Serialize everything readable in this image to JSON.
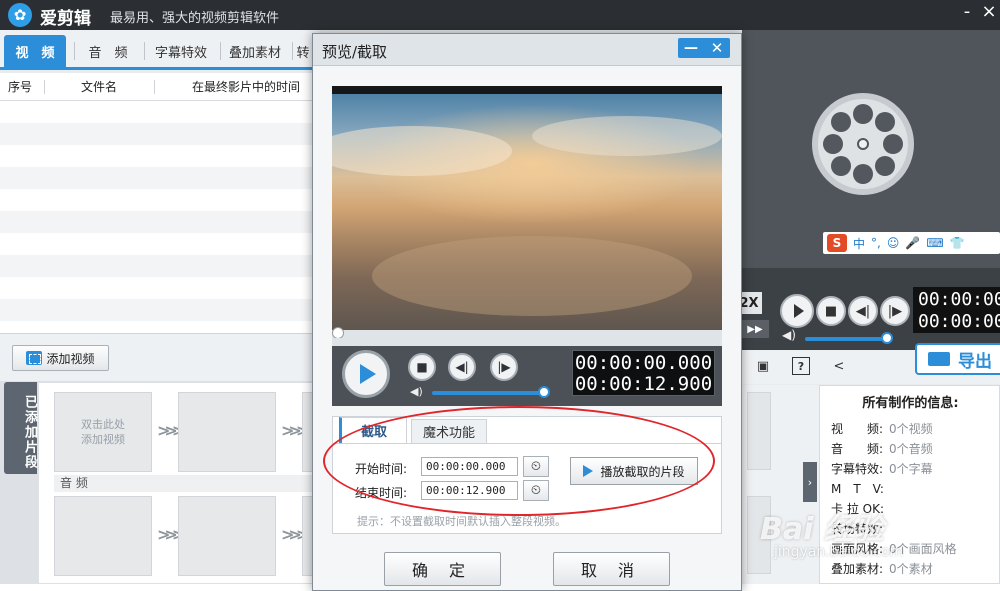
{
  "app": {
    "name": "爱剪辑",
    "slogan": "最易用、强大的视频剪辑软件"
  },
  "window_controls": {
    "minimize": "-",
    "close": "×"
  },
  "main_tabs": [
    {
      "label": "视　频",
      "active": true
    },
    {
      "label": "音　频",
      "active": false
    },
    {
      "label": "字幕特效",
      "active": false
    },
    {
      "label": "叠加素材",
      "active": false
    },
    {
      "label": "转",
      "active": false
    }
  ],
  "list": {
    "columns": [
      "序号",
      "文件名",
      "在最终影片中的时间"
    ]
  },
  "add_video_label": "添加视频",
  "storyboard": {
    "side_label": "已添加片段",
    "slot_hint": "双击此处\n添加视频",
    "audio_label": "音 频"
  },
  "dialog": {
    "title": "预览/截取",
    "min_label": "—",
    "close_label": "✕",
    "time_current": "00:00:00.000",
    "time_total": "00:00:12.900",
    "tabs": [
      "截取",
      "魔术功能"
    ],
    "start_label": "开始时间:",
    "start_value": "00:00:00.000",
    "end_label": "结束时间:",
    "end_value": "00:00:12.900",
    "play_segment_label": "播放截取的片段",
    "hint": "提示：不设置截取时间默认插入整段视频。",
    "ok_label": "确 定",
    "cancel_label": "取 消",
    "volume_level": 0.95,
    "progress": 0.0
  },
  "right_panel": {
    "speed_label": "2X",
    "ff_label": "▶▶",
    "time_current": "00:00:00",
    "time_total": "00:00:00",
    "export_label": "导出",
    "ime": {
      "logo": "S",
      "mode": "中",
      "punct": "°,",
      "items": [
        "☺",
        "🎤",
        "⌨",
        "👕"
      ]
    },
    "info_title": "所有制作的信息:",
    "info_rows": [
      {
        "label": "视　　频:",
        "value": "0个视频"
      },
      {
        "label": "音　　频:",
        "value": "0个音频"
      },
      {
        "label": "字幕特效:",
        "value": "0个字幕"
      },
      {
        "label": "M　T　V:",
        "value": ""
      },
      {
        "label": "卡 拉 OK:",
        "value": ""
      },
      {
        "label": "转场特效:",
        "value": ""
      },
      {
        "label": "画面风格:",
        "value": "0个画面风格"
      },
      {
        "label": "叠加素材:",
        "value": "0个素材"
      }
    ],
    "expand_arrow": "›"
  },
  "watermark": {
    "text": "Bai 经验",
    "url": "jingyan.baidu.com"
  },
  "colors": {
    "accent": "#2c8ed8",
    "titlebar": "#2b2f33",
    "annotation_circle": "#e0262b"
  }
}
